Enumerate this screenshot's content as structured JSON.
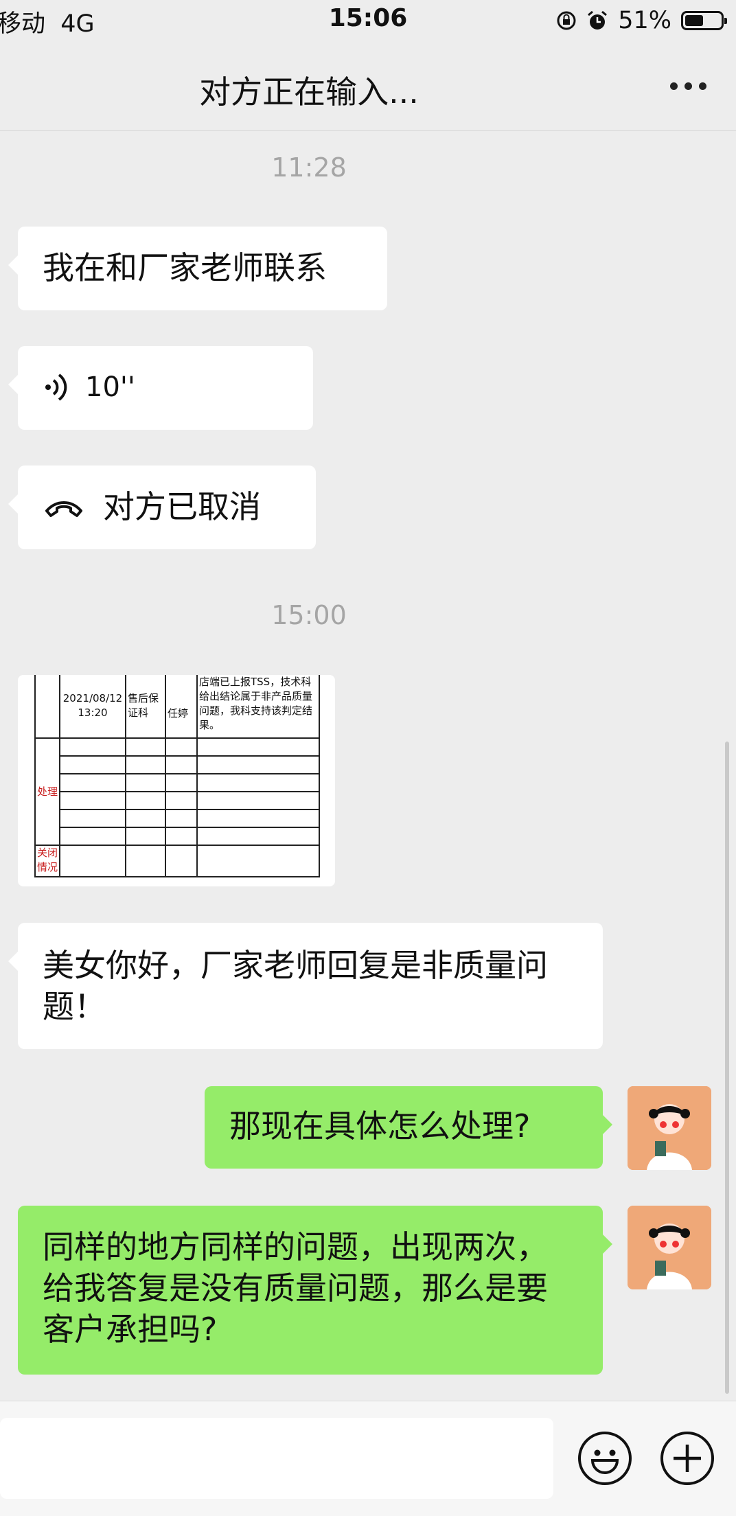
{
  "status_bar": {
    "carrier": "移动",
    "network": "4G",
    "time": "15:06",
    "battery": "51%",
    "battery_level": 0.51
  },
  "header": {
    "title": "对方正在输入..."
  },
  "messages": {
    "ts1": "11:28",
    "m1": "我在和厂家老师联系",
    "voice_duration": "10''",
    "call_status": "对方已取消",
    "ts2": "15:00",
    "m_reply": "美女你好，厂家老师回复是非质量问题！",
    "m_me1": "那现在具体怎么处理?",
    "m_me2": "同样的地方同样的问题，出现两次，给我答复是没有质量问题，那么是要客户承担吗?"
  },
  "image_table": {
    "date": "2021/08/12",
    "time": "13:20",
    "dept": "售后保证科",
    "person": "任婷",
    "note": "店端已上报TSS，技术科给出结论属于非产品质量问题，我科支持该判定结果。",
    "row_label_1": "处理",
    "row_label_2": "关闭情况"
  },
  "colors": {
    "background": "#ededed",
    "bubble_white": "#ffffff",
    "bubble_green": "#95ec69",
    "timestamp": "#a5a5a5"
  }
}
